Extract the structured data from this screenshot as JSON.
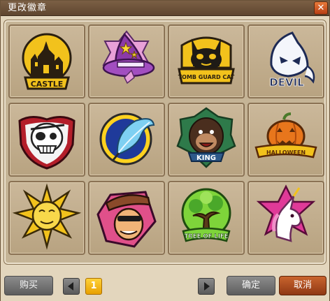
{
  "window": {
    "title": "更改徽章",
    "close_glyph": "✕"
  },
  "badges": [
    {
      "name": "castle",
      "label": "CASTLE",
      "icon": "castle-badge-icon"
    },
    {
      "name": "wizard-hat",
      "label": "",
      "icon": "wizard-hat-badge-icon"
    },
    {
      "name": "tomb-guard-cat",
      "label": "TOMB GUARD CAT",
      "icon": "tomb-guard-cat-badge-icon"
    },
    {
      "name": "devil",
      "label": "DEVIL",
      "icon": "devil-ghost-badge-icon"
    },
    {
      "name": "pirate-skull",
      "label": "",
      "icon": "pirate-skull-badge-icon"
    },
    {
      "name": "feather",
      "label": "",
      "icon": "feather-badge-icon"
    },
    {
      "name": "king-gorilla",
      "label": "KING",
      "icon": "king-gorilla-badge-icon"
    },
    {
      "name": "halloween",
      "label": "HALLOWEEN",
      "icon": "pumpkin-badge-icon"
    },
    {
      "name": "sun",
      "label": "",
      "icon": "sun-face-badge-icon"
    },
    {
      "name": "cowboy",
      "label": "",
      "icon": "cowboy-badge-icon"
    },
    {
      "name": "tree-of-life",
      "label": "TREE OF LIFE",
      "icon": "tree-of-life-badge-icon"
    },
    {
      "name": "unicorn",
      "label": "",
      "icon": "unicorn-badge-icon"
    }
  ],
  "footer": {
    "buy_label": "购买",
    "page": "1",
    "confirm_label": "确定",
    "cancel_label": "取消"
  },
  "colors": {
    "titlebar": "#6b5039",
    "panel": "#e3d6bd",
    "slot": "#c2ae8d",
    "cancel_accent": "#b04a1c",
    "page_indicator": "#f5b800"
  }
}
